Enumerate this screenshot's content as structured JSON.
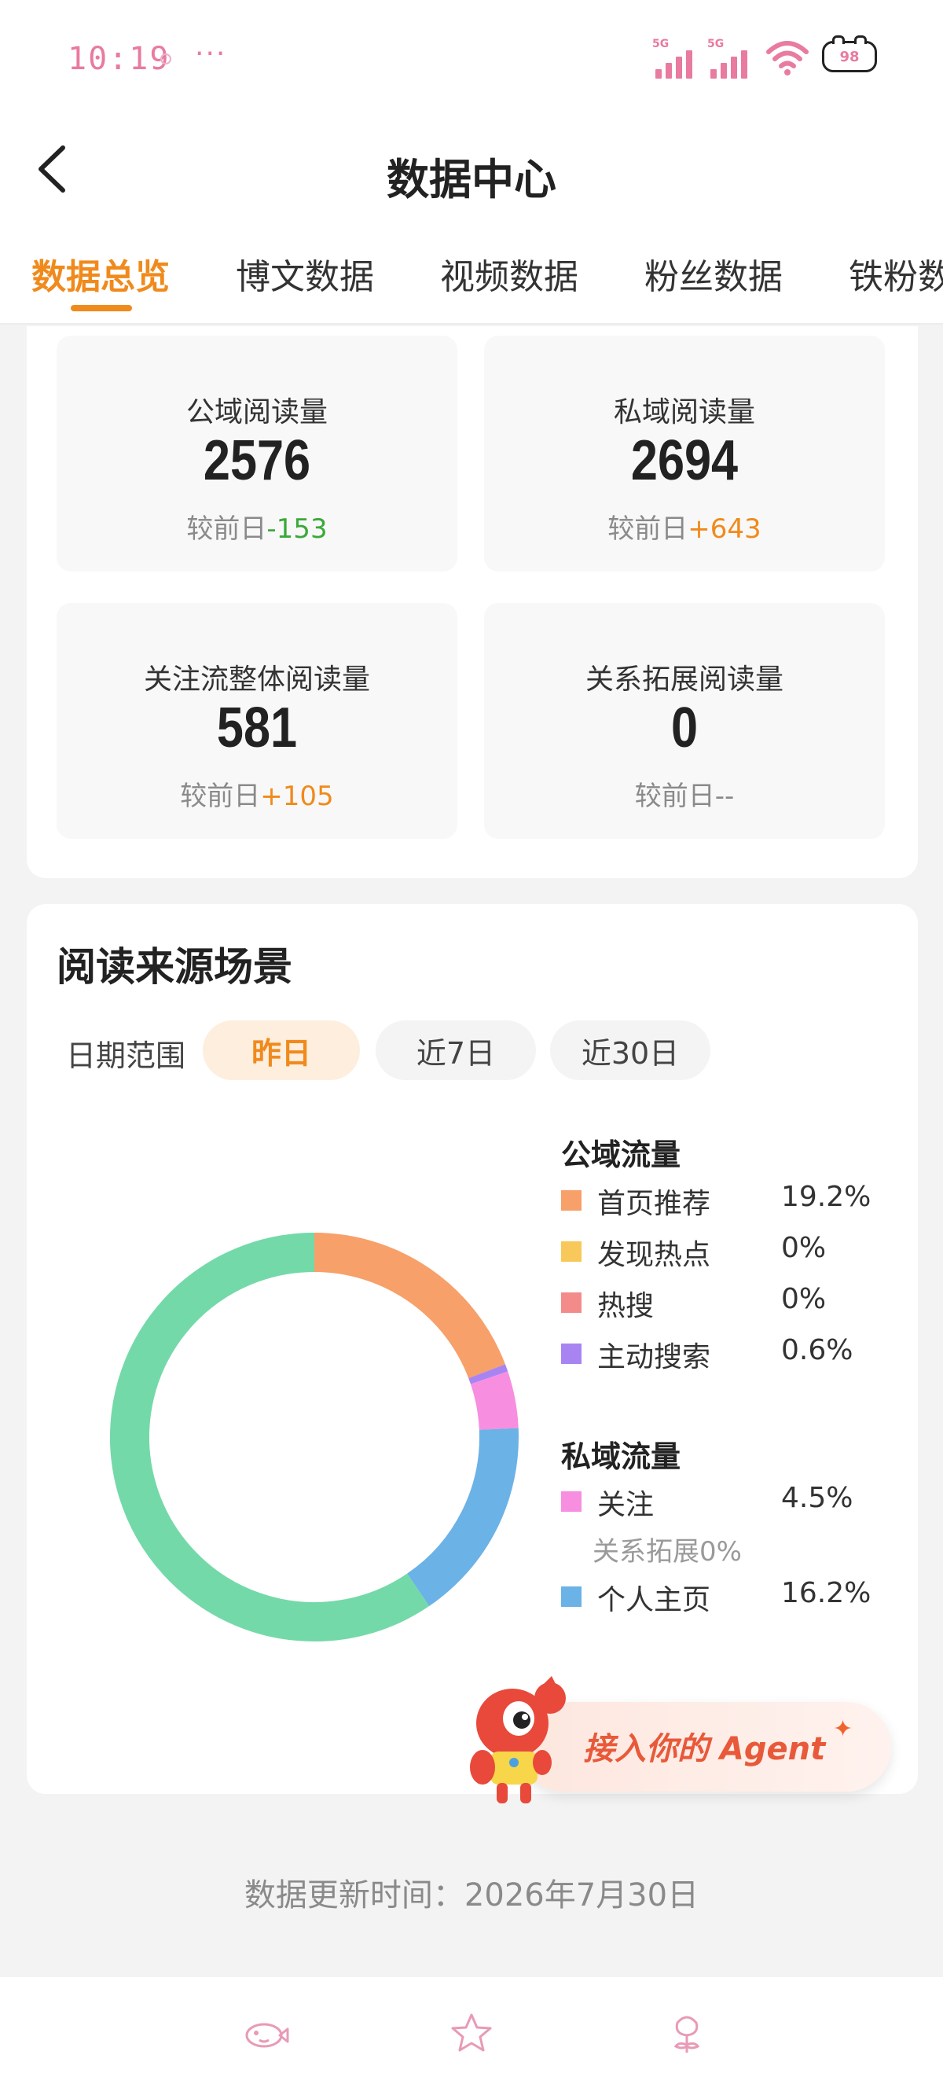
{
  "status_bar": {
    "time": "10:19",
    "more": "···",
    "signal1_tag": "5G",
    "signal2_tag": "5G",
    "battery": "98"
  },
  "header": {
    "title": "数据中心"
  },
  "tabs": [
    {
      "label": "数据总览"
    },
    {
      "label": "博文数据"
    },
    {
      "label": "视频数据"
    },
    {
      "label": "粉丝数据"
    },
    {
      "label": "铁粉数据"
    }
  ],
  "stats": [
    {
      "label": "公域阅读量",
      "value": "2576",
      "delta_prefix": "较前日",
      "delta": "-153",
      "trend": "down"
    },
    {
      "label": "私域阅读量",
      "value": "2694",
      "delta_prefix": "较前日",
      "delta": "+643",
      "trend": "up"
    },
    {
      "label": "关注流整体阅读量",
      "value": "581",
      "delta_prefix": "较前日",
      "delta": "+105",
      "trend": "up"
    },
    {
      "label": "关系拓展阅读量",
      "value": "0",
      "delta_prefix": "较前日",
      "delta": "--",
      "trend": "none"
    }
  ],
  "read_source": {
    "title": "阅读来源场景",
    "range_label": "日期范围",
    "ranges": [
      {
        "label": "昨日",
        "active": true
      },
      {
        "label": "近7日",
        "active": false
      },
      {
        "label": "近30日",
        "active": false
      }
    ],
    "public_title": "公域流量",
    "public_items": [
      {
        "name": "首页推荐",
        "pct": "19.2%",
        "color": "#f7a06a"
      },
      {
        "name": "发现热点",
        "pct": "0%",
        "color": "#f8c95a"
      },
      {
        "name": "热搜",
        "pct": "0%",
        "color": "#f38b8b"
      },
      {
        "name": "主动搜索",
        "pct": "0.6%",
        "color": "#a884f2"
      }
    ],
    "private_title": "私域流量",
    "private_items": [
      {
        "name": "关注",
        "pct": "4.5%",
        "color": "#f78ee0"
      },
      {
        "name": "个人主页",
        "pct": "16.2%",
        "color": "#6bb2e6"
      }
    ],
    "relation_note": "关系拓展0%"
  },
  "chart_data": {
    "type": "pie",
    "donut": true,
    "slices": [
      {
        "label": "首页推荐",
        "value": 19.2,
        "color": "#f7a06a"
      },
      {
        "label": "发现热点",
        "value": 0,
        "color": "#f8c95a"
      },
      {
        "label": "热搜",
        "value": 0,
        "color": "#f38b8b"
      },
      {
        "label": "主动搜索",
        "value": 0.6,
        "color": "#a884f2"
      },
      {
        "label": "关注",
        "value": 4.5,
        "color": "#f78ee0"
      },
      {
        "label": "关系拓展",
        "value": 0,
        "color": "#c9c9c9"
      },
      {
        "label": "个人主页",
        "value": 16.2,
        "color": "#6bb2e6"
      },
      {
        "label": "",
        "value": 59.5,
        "color": "#74d9a8"
      }
    ]
  },
  "agent_banner": {
    "text": "接入你的 Agent",
    "spark": "✦"
  },
  "footer": {
    "update_time": "数据更新时间：2026年7月30日"
  }
}
